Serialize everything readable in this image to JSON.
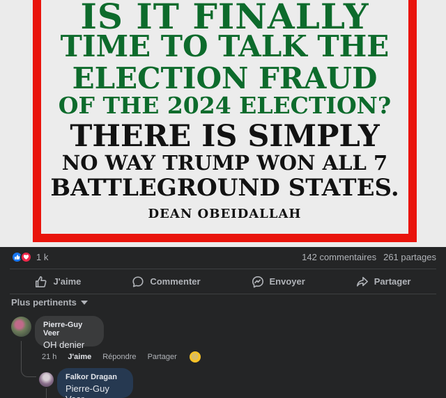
{
  "post_image": {
    "lines": [
      "IS IT FINALLY",
      "TIME TO TALK THE",
      "ELECTION FRAUD",
      "OF THE 2024 ELECTION?",
      "THERE IS SIMPLY",
      "NO WAY TRUMP WON ALL 7",
      "BATTLEGROUND STATES."
    ],
    "author": "DEAN OBEIDALLAH"
  },
  "stats": {
    "reaction_count": "1 k",
    "comments": "142 commentaires",
    "shares": "261 partages"
  },
  "actions": {
    "like": "J'aime",
    "comment": "Commenter",
    "send": "Envoyer",
    "share": "Partager"
  },
  "sort": {
    "label": "Plus pertinents"
  },
  "comments": [
    {
      "author": "Pierre-Guy Veer",
      "text": "OH denier",
      "time": "21 h",
      "like": "J'aime",
      "reply": "Répondre",
      "share": "Partager"
    },
    {
      "author": "Falkor Dragan",
      "text": "Pierre-Guy Veer"
    }
  ],
  "colors": {
    "background": "#242526",
    "frame_red": "#e9140c",
    "headline_green": "#0d6b2c",
    "like_blue": "#1877f2",
    "love_red": "#f0284a"
  },
  "icons": [
    "like-reaction-icon",
    "love-reaction-icon",
    "thumb-up-icon",
    "comment-icon",
    "messenger-icon",
    "share-icon",
    "chevron-down-icon",
    "emoji-icon"
  ]
}
